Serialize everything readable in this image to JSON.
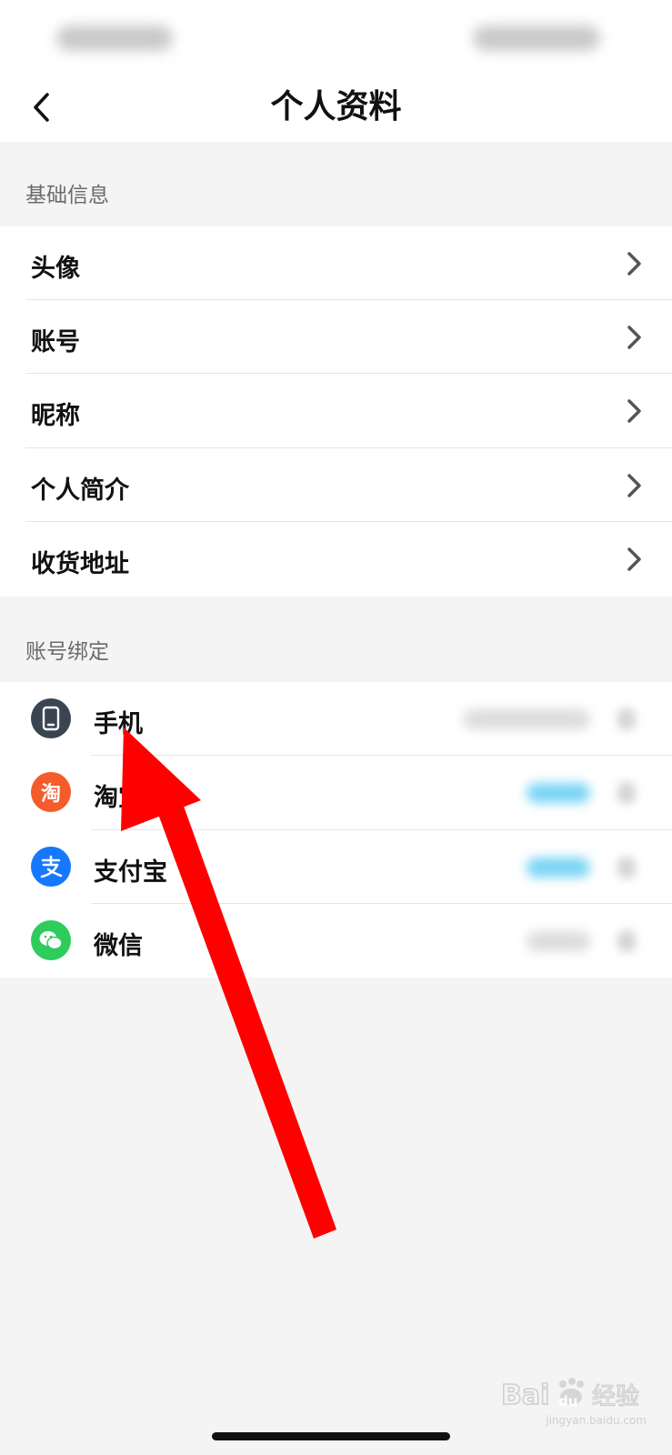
{
  "nav": {
    "title": "个人资料",
    "back_icon": "chevron-left-icon"
  },
  "basic_info": {
    "header": "基础信息",
    "items": [
      {
        "label": "头像"
      },
      {
        "label": "账号"
      },
      {
        "label": "昵称"
      },
      {
        "label": "个人简介"
      },
      {
        "label": "收货地址"
      }
    ]
  },
  "bindings": {
    "header": "账号绑定",
    "items": [
      {
        "label": "手机",
        "icon": "phone-icon",
        "icon_color": "#3a4552"
      },
      {
        "label": "淘宝",
        "icon": "taobao-icon",
        "icon_color": "#f45c2c",
        "icon_text": "淘"
      },
      {
        "label": "支付宝",
        "icon": "alipay-icon",
        "icon_color": "#1677ff"
      },
      {
        "label": "微信",
        "icon": "wechat-icon",
        "icon_color": "#2ecc5b"
      }
    ]
  },
  "watermark": {
    "logo_text": "Bai du 经验",
    "url": "jingyan.baidu.com"
  },
  "colors": {
    "arrow": "#ff0000",
    "background": "#f4f4f4",
    "status_blue": "#7ad4f5"
  }
}
